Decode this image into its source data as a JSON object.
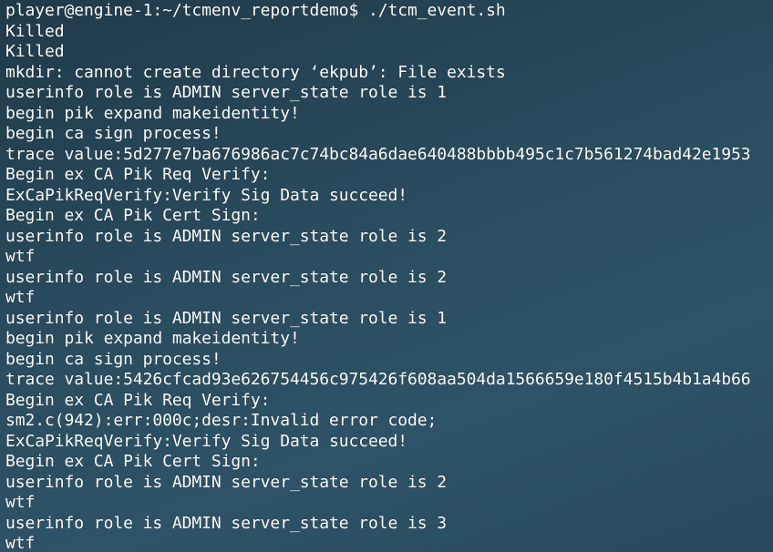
{
  "terminal": {
    "lines": [
      "player@engine-1:~/tcmenv_reportdemo$ ./tcm_event.sh",
      "Killed",
      "Killed",
      "mkdir: cannot create directory ‘ekpub’: File exists",
      "userinfo role is ADMIN server_state role is 1",
      "begin pik expand makeidentity!",
      "begin ca sign process!",
      "trace value:5d277e7ba676986ac7c74bc84a6dae640488bbbb495c1c7b561274bad42e1953",
      "Begin ex CA Pik Req Verify:",
      "ExCaPikReqVerify:Verify Sig Data succeed!",
      "Begin ex CA Pik Cert Sign:",
      "userinfo role is ADMIN server_state role is 2",
      "wtf",
      "userinfo role is ADMIN server_state role is 2",
      "wtf",
      "userinfo role is ADMIN server_state role is 1",
      "begin pik expand makeidentity!",
      "begin ca sign process!",
      "trace value:5426cfcad93e626754456c975426f608aa504da1566659e180f4515b4b1a4b66",
      "Begin ex CA Pik Req Verify:",
      "sm2.c(942):err:000c;desr:Invalid error code;",
      "ExCaPikReqVerify:Verify Sig Data succeed!",
      "Begin ex CA Pik Cert Sign:",
      "userinfo role is ADMIN server_state role is 2",
      "wtf",
      "userinfo role is ADMIN server_state role is 3",
      "wtf"
    ]
  },
  "colors": {
    "text": "#ffffff",
    "background_top": "#203a4a",
    "background_bottom": "#2e5366"
  }
}
